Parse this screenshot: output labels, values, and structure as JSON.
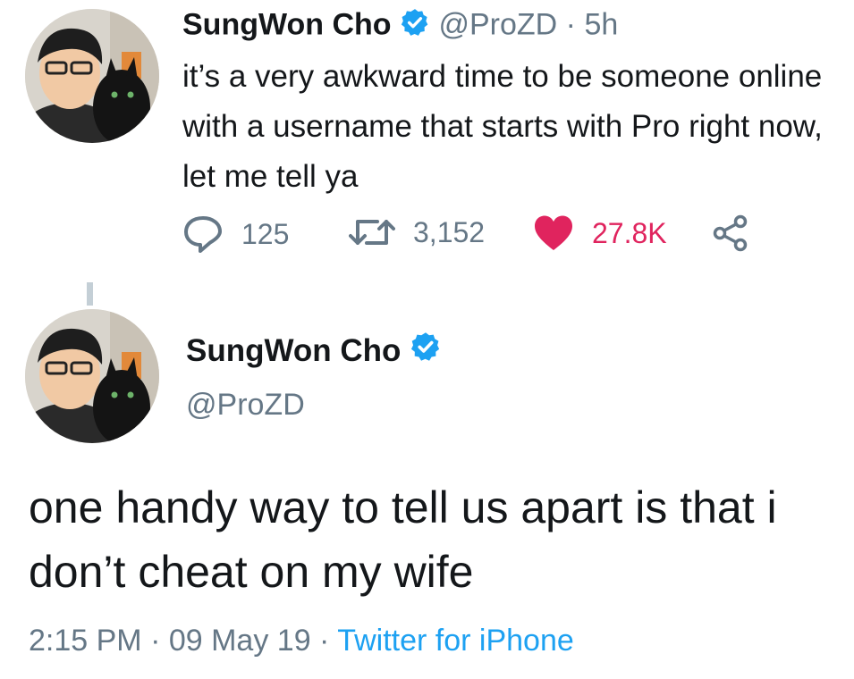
{
  "tweet1": {
    "display_name": "SungWon Cho",
    "handle": "@ProZD",
    "dot": "·",
    "time": "5h",
    "text": "it’s a very awkward time to be someone online with a username that starts with Pro right now, let me tell ya",
    "actions": {
      "replies": "125",
      "retweets": "3,152",
      "likes": "27.8K"
    }
  },
  "tweet2": {
    "display_name": "SungWon Cho",
    "handle": "@ProZD",
    "text": "one handy way to tell us apart is that i don’t cheat on my wife",
    "footer": {
      "time": "2:15 PM",
      "sep1": " · ",
      "date": "09 May 19",
      "sep2": " · ",
      "source": "Twitter for iPhone"
    }
  },
  "colors": {
    "text": "#14171a",
    "muted": "#657786",
    "link": "#1da1f2",
    "like": "#e0245e",
    "verified": "#1da1f2"
  },
  "icons": [
    "verified-badge-icon",
    "reply-icon",
    "retweet-icon",
    "heart-icon",
    "share-icon"
  ]
}
